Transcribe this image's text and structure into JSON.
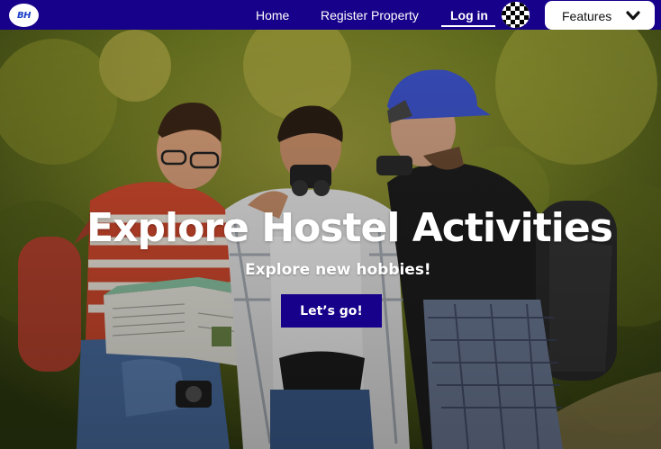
{
  "logo": {
    "text": "BH"
  },
  "nav": {
    "home_label": "Home",
    "register_label": "Register Property",
    "login_label": "Log in",
    "features_label": "Features"
  },
  "hero": {
    "title": "Explore Hostel Activities",
    "subtitle": "Explore new hobbies!",
    "cta_label": "Let’s go!"
  },
  "colors": {
    "nav_background": "#17008a",
    "cta_background": "#17008a",
    "text_light": "#ffffff"
  },
  "icons": {
    "logo": "bh-logo-icon",
    "avatar": "checkered-avatar-icon",
    "dropdown": "chevron-down-icon"
  }
}
